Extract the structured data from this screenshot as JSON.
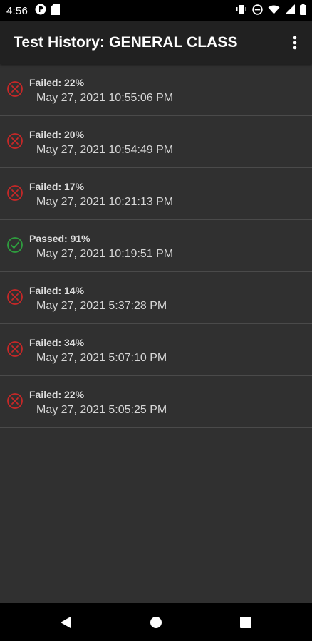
{
  "status_bar": {
    "time": "4:56",
    "left_icons": [
      "notification-p-icon",
      "sd-card-icon"
    ],
    "right_icons": [
      "vibrate-icon",
      "do-not-disturb-icon",
      "wifi-icon",
      "signal-icon",
      "battery-icon"
    ]
  },
  "app_bar": {
    "title": "Test History: GENERAL CLASS",
    "menu_icon": "more-vert-icon"
  },
  "colors": {
    "fail": "#c62828",
    "pass": "#2e9e3e",
    "background": "#303030",
    "app_bar": "#212121"
  },
  "history": [
    {
      "status": "fail",
      "result": "Failed: 22%",
      "date": "May 27, 2021 10:55:06 PM"
    },
    {
      "status": "fail",
      "result": "Failed: 20%",
      "date": "May 27, 2021 10:54:49 PM"
    },
    {
      "status": "fail",
      "result": "Failed: 17%",
      "date": "May 27, 2021 10:21:13 PM"
    },
    {
      "status": "pass",
      "result": "Passed: 91%",
      "date": "May 27, 2021 10:19:51 PM"
    },
    {
      "status": "fail",
      "result": "Failed: 14%",
      "date": "May 27, 2021 5:37:28 PM"
    },
    {
      "status": "fail",
      "result": "Failed: 34%",
      "date": "May 27, 2021 5:07:10 PM"
    },
    {
      "status": "fail",
      "result": "Failed: 22%",
      "date": "May 27, 2021 5:05:25 PM"
    }
  ],
  "nav_bar": {
    "buttons": [
      "back-icon",
      "home-icon",
      "recents-icon"
    ]
  }
}
